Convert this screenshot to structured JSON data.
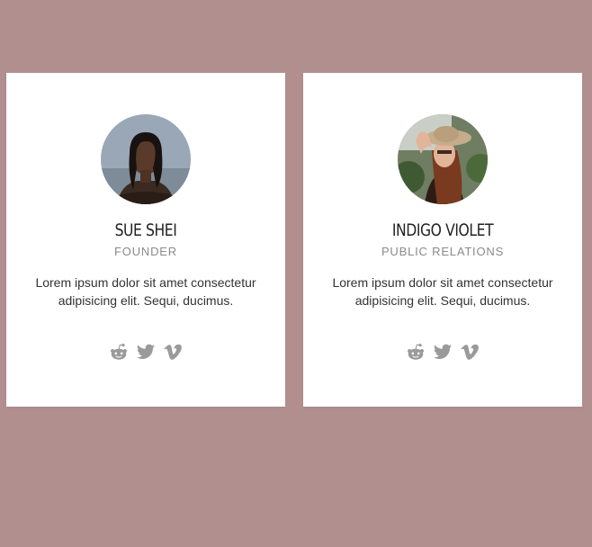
{
  "cards": [
    {
      "name": "SUE SHEI",
      "role": "FOUNDER",
      "description": "Lorem ipsum dolor sit amet consectetur adipisicing elit. Sequi, ducimus.",
      "social": [
        "reddit-icon",
        "twitter-icon",
        "vimeo-icon"
      ]
    },
    {
      "name": "INDIGO VIOLET",
      "role": "PUBLIC RELATIONS",
      "description": "Lorem ipsum dolor sit amet consectetur adipisicing elit. Sequi, ducimus.",
      "social": [
        "reddit-icon",
        "twitter-icon",
        "vimeo-icon"
      ]
    }
  ],
  "colors": {
    "background": "#b28f8f",
    "card": "#ffffff",
    "icon": "#9a9a9a"
  }
}
